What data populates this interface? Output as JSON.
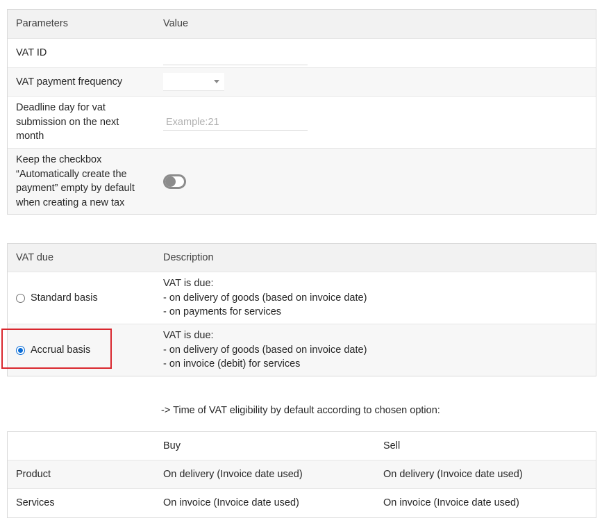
{
  "params_table": {
    "headers": [
      "Parameters",
      "Value"
    ],
    "rows": {
      "vat_id": {
        "label": "VAT ID",
        "value": ""
      },
      "vat_payment_frequency": {
        "label": "VAT payment frequency",
        "selected": ""
      },
      "deadline": {
        "label_lines": [
          "Deadline day for vat",
          "submission on the next",
          "month"
        ],
        "placeholder": "Example:21",
        "value": ""
      },
      "keep_checkbox": {
        "label_lines": [
          "Keep the checkbox",
          "“Automatically create the",
          "payment” empty by default",
          "when creating a new tax"
        ],
        "toggle_on": false
      }
    }
  },
  "vat_due_table": {
    "headers": [
      "VAT due",
      "Description"
    ],
    "options": [
      {
        "label": "Standard basis",
        "selected": false,
        "description": [
          "VAT is due:",
          "- on delivery of goods (based on invoice date)",
          "- on payments for services"
        ]
      },
      {
        "label": "Accrual basis",
        "selected": true,
        "description": [
          "VAT is due:",
          "- on delivery of goods (based on invoice date)",
          "- on invoice (debit) for services"
        ]
      }
    ]
  },
  "note": "-> Time of VAT eligibility by default according to chosen option:",
  "eligibility_table": {
    "headers": [
      "",
      "Buy",
      "Sell"
    ],
    "rows": [
      [
        "Product",
        "On delivery (Invoice date used)",
        "On delivery (Invoice date used)"
      ],
      [
        "Services",
        "On invoice (Invoice date used)",
        "On invoice (Invoice date used)"
      ]
    ]
  },
  "colors": {
    "header_bg": "#f2f2f2",
    "highlight": "#d9272e",
    "radio_checked": "#0a6cd6",
    "toggle": "#8c8c8c"
  }
}
